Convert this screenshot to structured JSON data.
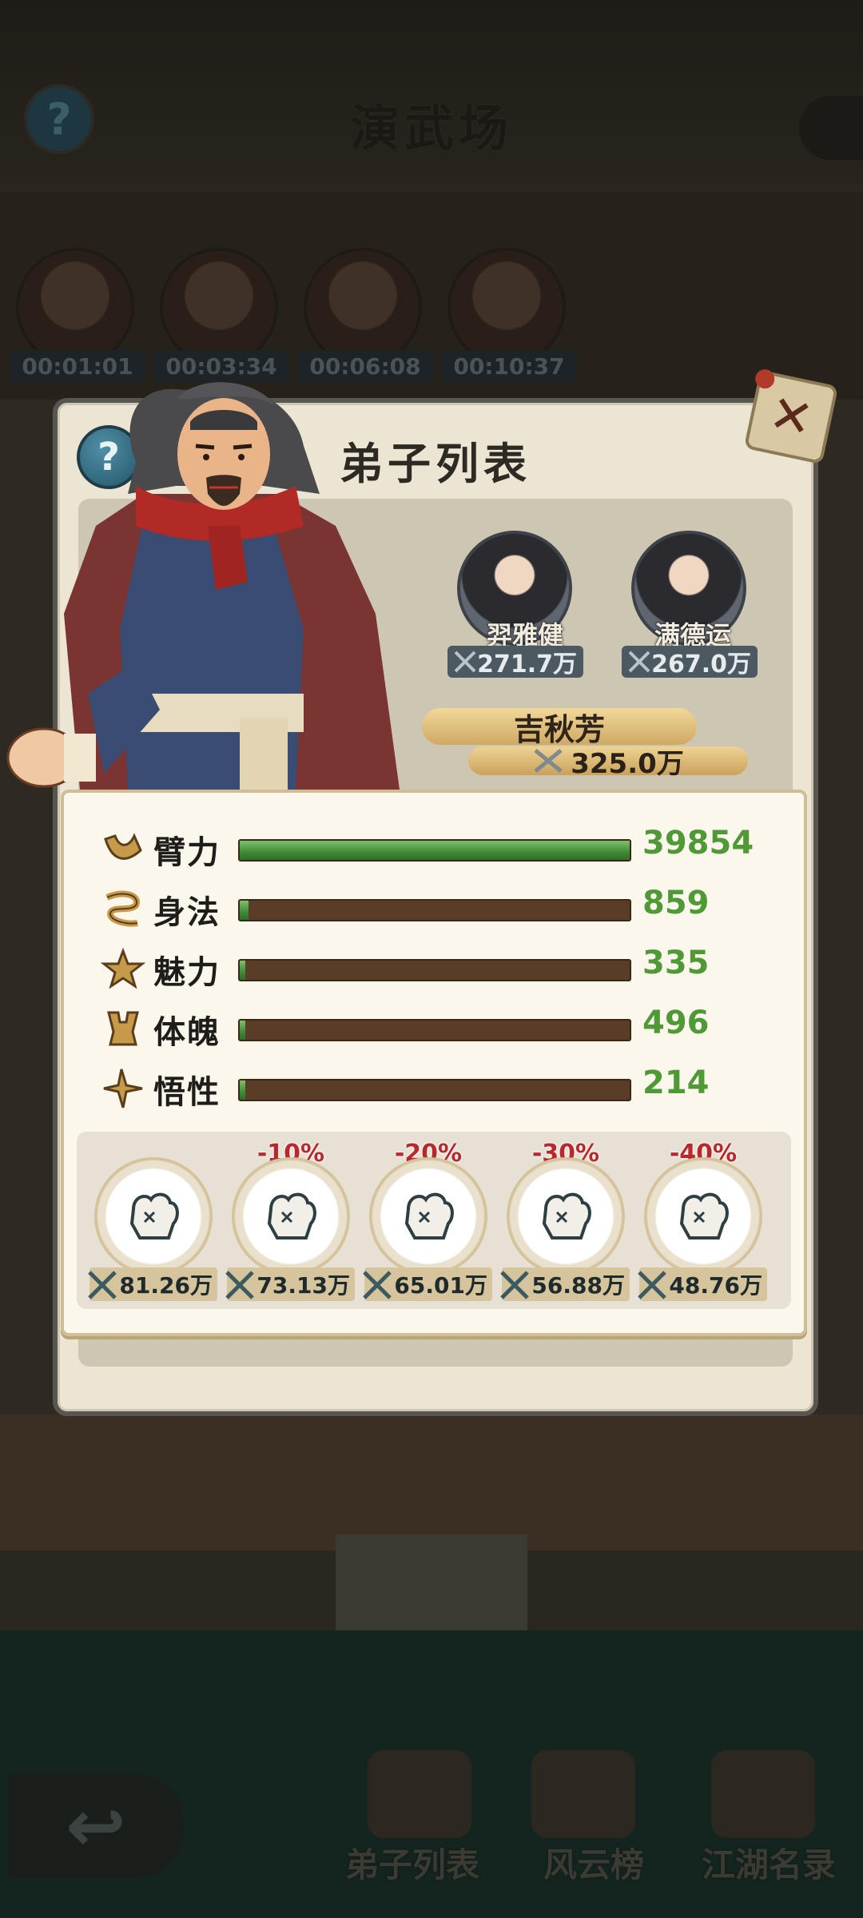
{
  "scene": {
    "title": "演武场",
    "help_symbol": "?",
    "timers": [
      "00:01:01",
      "00:03:34",
      "00:06:08",
      "00:10:37"
    ],
    "nav": [
      "弟子列表",
      "风云榜",
      "江湖名录"
    ],
    "back_symbol": "↩"
  },
  "modal": {
    "title": "弟子列表",
    "help_symbol": "?",
    "close_symbol": "✕",
    "disciples": [
      {
        "name": "羿雅健",
        "power": "271.7万"
      },
      {
        "name": "满德运",
        "power": "267.0万"
      }
    ],
    "selected": {
      "name": "吉秋芳",
      "power": "325.0万"
    }
  },
  "stats": [
    {
      "label": "臂力",
      "value": "39854",
      "icon": "arm-strength-icon",
      "fill": 1.0
    },
    {
      "label": "身法",
      "value": "859",
      "icon": "agility-icon",
      "fill": 0.022
    },
    {
      "label": "魅力",
      "value": "335",
      "icon": "charm-icon",
      "fill": 0.008
    },
    {
      "label": "体魄",
      "value": "496",
      "icon": "constitution-icon",
      "fill": 0.012
    },
    {
      "label": "悟性",
      "value": "214",
      "icon": "insight-icon",
      "fill": 0.005
    }
  ],
  "skills": [
    {
      "penalty": "",
      "power": "81.26万"
    },
    {
      "penalty": "-10%",
      "power": "73.13万"
    },
    {
      "penalty": "-20%",
      "power": "65.01万"
    },
    {
      "penalty": "-30%",
      "power": "56.88万"
    },
    {
      "penalty": "-40%",
      "power": "48.76万"
    }
  ],
  "colors": {
    "stat_value": "#4f9a36",
    "penalty": "#b8282d",
    "bar_fill": "#3f8a37",
    "bar_track": "#5a3d26"
  }
}
